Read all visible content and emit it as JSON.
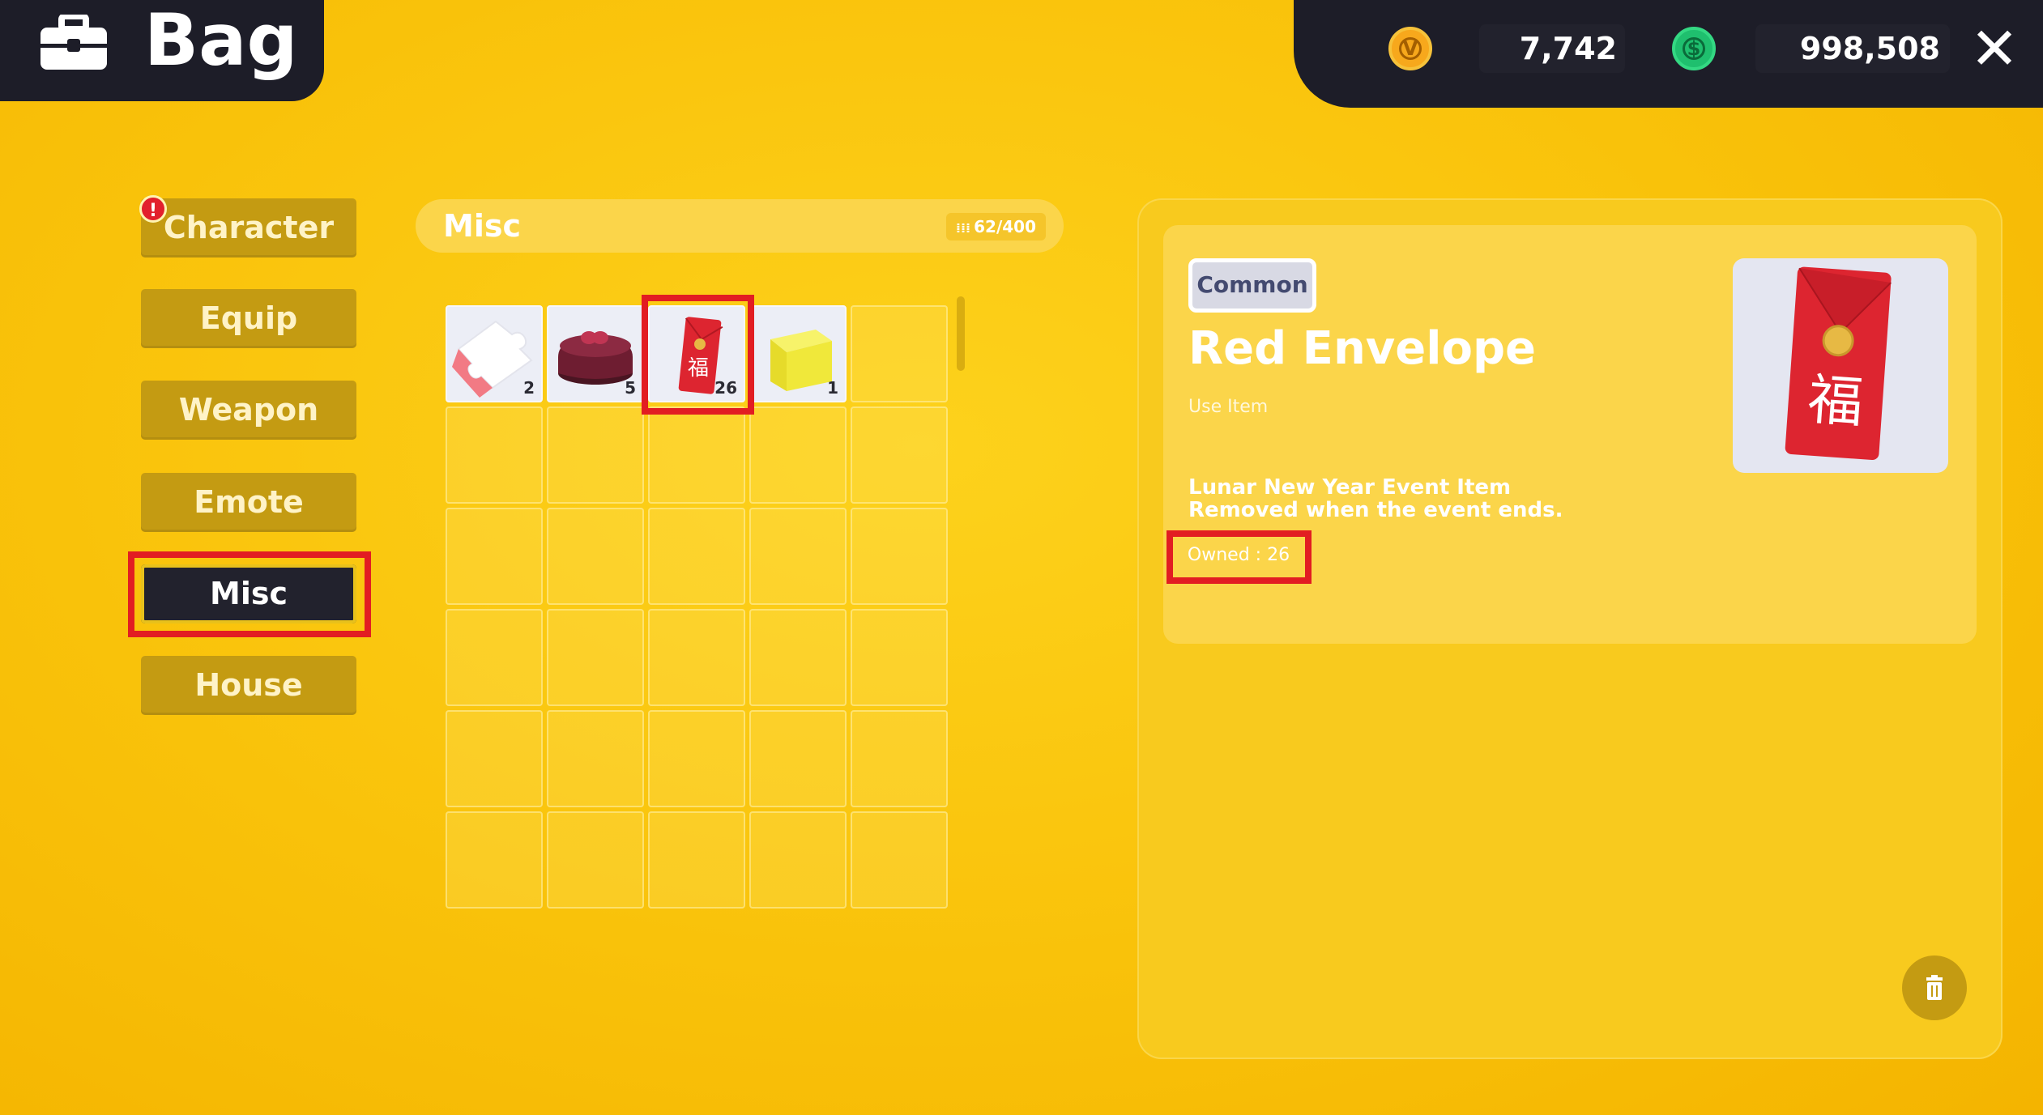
{
  "header": {
    "title": "Bag",
    "icon": "bag-icon"
  },
  "currency": {
    "gold": {
      "icon": "gold-coin-icon",
      "symbol": "V",
      "value": "7,742"
    },
    "green": {
      "icon": "green-coin-icon",
      "symbol": "$",
      "value": "998,508"
    },
    "close_label": "✕"
  },
  "categories": [
    {
      "label": "Character",
      "alert": "!"
    },
    {
      "label": "Equip"
    },
    {
      "label": "Weapon"
    },
    {
      "label": "Emote"
    },
    {
      "label": "Misc",
      "active": true
    },
    {
      "label": "House"
    }
  ],
  "inventory": {
    "section_title": "Misc",
    "capacity_icon": "⁞⁞⁞",
    "capacity": "62/400",
    "items": [
      {
        "name": "Puzzle Piece",
        "icon": "puzzle-piece-icon",
        "qty": "2"
      },
      {
        "name": "Cake",
        "icon": "cake-icon",
        "qty": "5"
      },
      {
        "name": "Red Envelope",
        "icon": "red-envelope-icon",
        "qty": "26",
        "selected": true
      },
      {
        "name": "Yellow Cube",
        "icon": "yellow-cube-icon",
        "qty": "1"
      }
    ]
  },
  "detail": {
    "rarity": "Common",
    "name": "Red Envelope",
    "type": "Use Item",
    "desc_line1": "Lunar New Year Event Item",
    "desc_line2": "Removed when the event ends.",
    "owned": "Owned : 26",
    "preview_glyph": "福",
    "delete_icon": "trash-icon"
  },
  "colors": {
    "accent": "#f9c20a",
    "dark": "#1d1d28",
    "highlight": "#e21d22",
    "button": "#c49b12"
  }
}
